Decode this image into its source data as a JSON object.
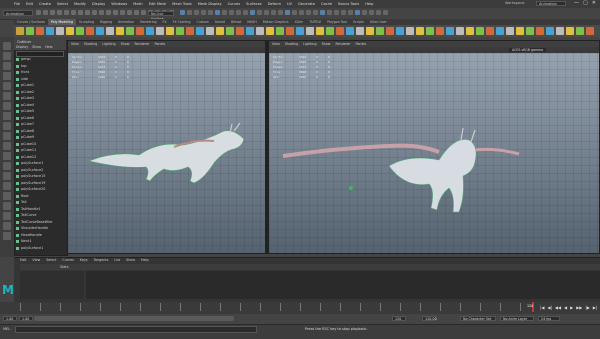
{
  "menubar": {
    "items": [
      "File",
      "Edit",
      "Create",
      "Select",
      "Modify",
      "Display",
      "Windows",
      "Mesh",
      "Edit Mesh",
      "Mesh Tools",
      "Mesh Display",
      "Curves",
      "Surfaces",
      "Deform",
      "UV",
      "Generate",
      "Cache",
      "Bonus Tools",
      "Help"
    ],
    "workspace_label": "Workspace:",
    "workspace_value": "Animation",
    "window_controls": [
      "—",
      "▢",
      "✕"
    ]
  },
  "status": {
    "mode": "Animation",
    "live_surface": "No Live Surface"
  },
  "shelf": {
    "tabs": [
      "Curves / Surfaces",
      "Poly Modeling",
      "Sculpting",
      "Rigging",
      "Animation",
      "Rendering",
      "FX",
      "FX Caching",
      "Custom",
      "Arnold",
      "Bifrost",
      "MASH",
      "Motion Graphics",
      "XGen",
      "TURTLE",
      "Polygon Tool",
      "Scripts",
      "XGen User"
    ],
    "active_tab": "Poly Modeling",
    "icon_colors": [
      "#c9a43a",
      "#7fbf4a",
      "#d06a3a",
      "#4aa0d0",
      "#bcbcbc",
      "#e0c040",
      "#7fbf4a",
      "#d06a3a",
      "#4aa0d0",
      "#bcbcbc",
      "#e0c040",
      "#7fbf4a",
      "#d06a3a",
      "#4aa0d0",
      "#bcbcbc",
      "#e0c040",
      "#7fbf4a",
      "#d06a3a",
      "#4aa0d0",
      "#bcbcbc",
      "#e0c040",
      "#7fbf4a",
      "#d06a3a",
      "#4aa0d0",
      "#bcbcbc",
      "#e0c040",
      "#7fbf4a",
      "#d06a3a",
      "#4aa0d0",
      "#bcbcbc",
      "#e0c040",
      "#7fbf4a",
      "#d06a3a",
      "#4aa0d0",
      "#bcbcbc",
      "#e0c040",
      "#7fbf4a",
      "#d06a3a",
      "#4aa0d0",
      "#bcbcbc",
      "#e0c040",
      "#7fbf4a",
      "#d06a3a",
      "#4aa0d0",
      "#bcbcbc",
      "#e0c040",
      "#7fbf4a",
      "#d06a3a",
      "#4aa0d0",
      "#bcbcbc",
      "#e0c040",
      "#7fbf4a",
      "#d06a3a",
      "#4aa0d0",
      "#bcbcbc",
      "#e0c040",
      "#7fbf4a",
      "#d06a3a"
    ]
  },
  "outliner": {
    "title": "Outliner",
    "menu": [
      "Display",
      "Show",
      "Help"
    ],
    "items": [
      "persp",
      "top",
      "front",
      "side",
      "pCube1",
      "pCube2",
      "pCube3",
      "pCube4",
      "pCube5",
      "pCube6",
      "pCube7",
      "pCube8",
      "pCube9",
      "pCube10",
      "pCube11",
      "pCube12",
      "polySurface1",
      "polySurface2",
      "polySurface15",
      "polySurface19",
      "polySurface20",
      "Root",
      "Tail",
      "TailHandle1",
      "TailCurve",
      "TailCurveBaseWire",
      "ShoulderHandle",
      "HeadHandle",
      "Neck1",
      "polySurface1"
    ]
  },
  "viewports": [
    {
      "menu": [
        "View",
        "Shading",
        "Lighting",
        "Show",
        "Renderer",
        "Panels"
      ],
      "hud": [
        {
          "label": "Verts:",
          "a": "1913",
          "b": "0",
          "c": "0"
        },
        {
          "label": "Edges:",
          "a": "3825",
          "b": "0",
          "c": "0"
        },
        {
          "label": "Faces:",
          "a": "1913",
          "b": "0",
          "c": "0"
        },
        {
          "label": "Tris:",
          "a": "3826",
          "b": "0",
          "c": "0"
        },
        {
          "label": "UVs:",
          "a": "1946",
          "b": "0",
          "c": "0"
        }
      ]
    },
    {
      "menu": [
        "View",
        "Shading",
        "Lighting",
        "Show",
        "Renderer",
        "Panels"
      ],
      "hud": [
        {
          "label": "Verts:",
          "a": "1913",
          "b": "0",
          "c": "0"
        },
        {
          "label": "Edges:",
          "a": "3825",
          "b": "0",
          "c": "0"
        },
        {
          "label": "Faces:",
          "a": "1913",
          "b": "0",
          "c": "0"
        },
        {
          "label": "Tris:",
          "a": "3826",
          "b": "0",
          "c": "0"
        },
        {
          "label": "UVs:",
          "a": "1946",
          "b": "0",
          "c": "0"
        }
      ],
      "color_space": "ACES sRGB gamma"
    }
  ],
  "graph_editor": {
    "menu": [
      "Edit",
      "View",
      "Select",
      "Curves",
      "Keys",
      "Tangents",
      "List",
      "Show",
      "Help"
    ],
    "stats_label": "Stats"
  },
  "timeline": {
    "controls": [
      "|◀",
      "◀|",
      "◀◀",
      "◀",
      "▶",
      "▶▶",
      "|▶",
      "▶|"
    ],
    "current_frame": "120"
  },
  "range": {
    "start": "1.00",
    "anim_start": "1.00",
    "end": "120",
    "anim_end": "120.00",
    "character_set": "No Character Set",
    "anim_layer": "No Anim Layer",
    "fps": "24 fps"
  },
  "help": {
    "mel_label": "MEL",
    "message": "Press the ESC key to stop playback."
  }
}
